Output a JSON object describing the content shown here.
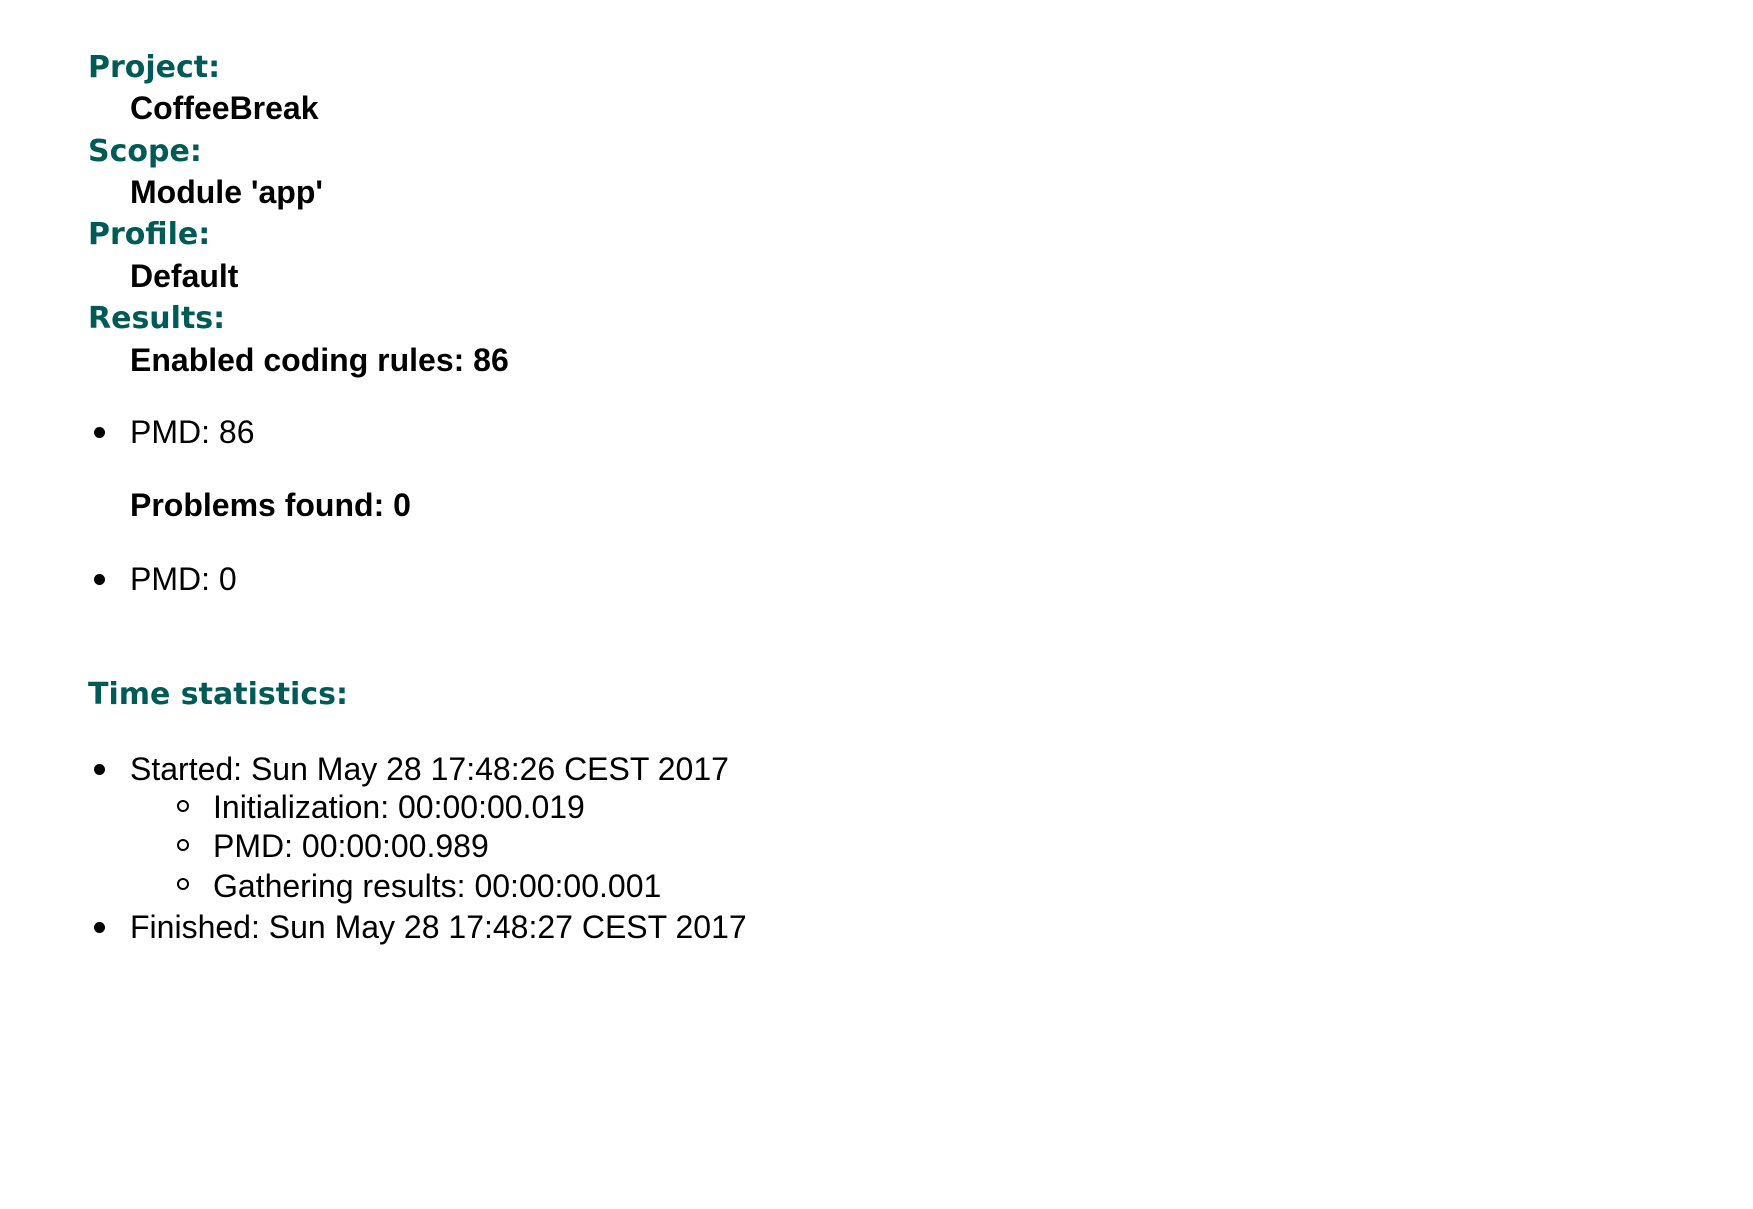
{
  "project": {
    "label": "Project:",
    "value": "CoffeeBreak"
  },
  "scope": {
    "label": "Scope:",
    "value": "Module 'app'"
  },
  "profile": {
    "label": "Profile:",
    "value": "Default"
  },
  "results": {
    "label": "Results:",
    "enabled_rules": "Enabled coding rules: 86",
    "enabled_items": [
      "PMD: 86"
    ],
    "problems": "Problems found: 0",
    "problem_items": [
      "PMD: 0"
    ]
  },
  "time_statistics": {
    "label": "Time statistics:",
    "started": "Started: Sun May 28 17:48:26 CEST 2017",
    "phases": [
      "Initialization: 00:00:00.019",
      "PMD: 00:00:00.989",
      "Gathering results: 00:00:00.001"
    ],
    "finished": "Finished: Sun May 28 17:48:27 CEST 2017"
  }
}
